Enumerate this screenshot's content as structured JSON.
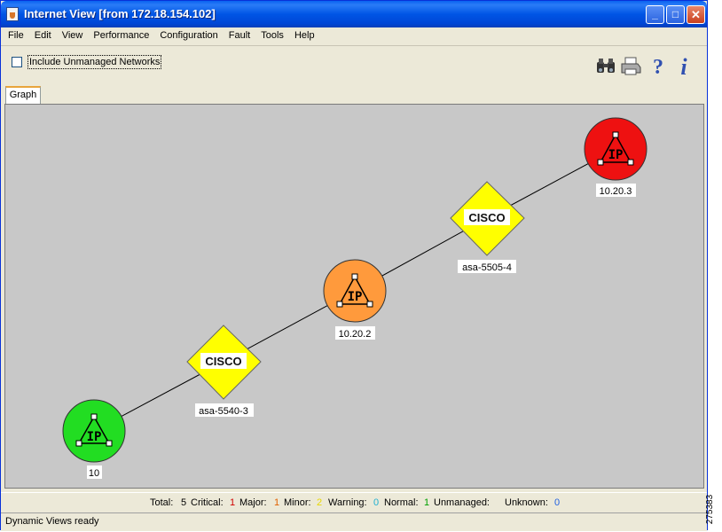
{
  "window": {
    "title": "Internet View [from 172.18.154.102]",
    "controls": {
      "minimize": "_",
      "maximize": "□",
      "close": "✕"
    }
  },
  "menu": [
    "File",
    "Edit",
    "View",
    "Performance",
    "Configuration",
    "Fault",
    "Tools",
    "Help"
  ],
  "toolbar": {
    "checkbox_label": "Include Unmanaged Networks",
    "checkbox_checked": false,
    "icons": [
      "binoculars-icon",
      "printer-icon",
      "help-icon",
      "info-icon"
    ]
  },
  "tabs": [
    {
      "label": "Graph",
      "active": true
    }
  ],
  "graph": {
    "nodes": [
      {
        "id": "n1",
        "label": "10",
        "kind": "ip",
        "color": "#22dd22",
        "glyph": "IP"
      },
      {
        "id": "n2",
        "label": "asa-5540-3",
        "kind": "cisco",
        "color": "#ffff00",
        "glyph": "CISCO"
      },
      {
        "id": "n3",
        "label": "10.20.2",
        "kind": "ip",
        "color": "#ff9a3c",
        "glyph": "IP"
      },
      {
        "id": "n4",
        "label": "asa-5505-4",
        "kind": "cisco",
        "color": "#ffff00",
        "glyph": "CISCO"
      },
      {
        "id": "n5",
        "label": "10.20.3",
        "kind": "ip",
        "color": "#ee1111",
        "glyph": "IP"
      }
    ]
  },
  "stats": {
    "total_label": "Total:",
    "total": "5",
    "critical_label": "Critical:",
    "critical": "1",
    "critical_color": "#d00000",
    "major_label": "Major:",
    "major": "1",
    "major_color": "#e06000",
    "minor_label": "Minor:",
    "minor": "2",
    "minor_color": "#e8d800",
    "warning_label": "Warning:",
    "warning": "0",
    "warning_color": "#20b0d0",
    "normal_label": "Normal:",
    "normal": "1",
    "normal_color": "#00a000",
    "unmanaged_label": "Unmanaged:",
    "unknown_label": "Unknown:",
    "unknown": "0",
    "unknown_color": "#2060e0"
  },
  "status": "Dynamic Views ready",
  "side_id": "275383"
}
